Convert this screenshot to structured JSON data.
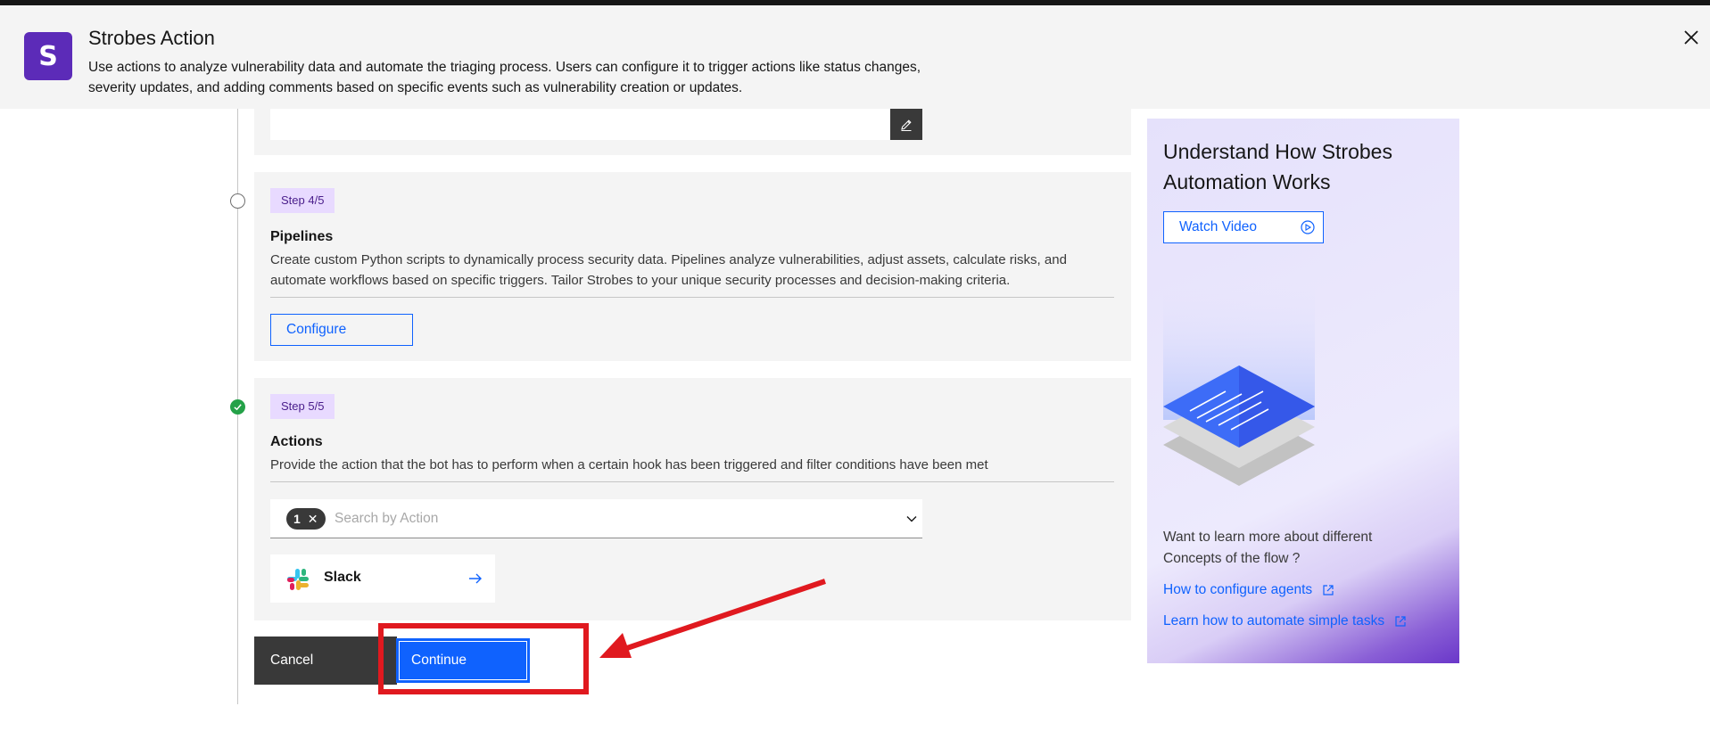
{
  "header": {
    "logo_letter": "S",
    "title": "Strobes Action",
    "description": "Use actions to analyze vulnerability data and automate the triaging process. Users can configure it to trigger actions like status changes, severity updates, and adding comments based on specific events such as vulnerability creation or updates."
  },
  "steps": {
    "step4": {
      "tag": "Step 4/5",
      "title": "Pipelines",
      "description": "Create custom Python scripts to dynamically process security data. Pipelines analyze vulnerabilities, adjust assets, calculate risks, and automate workflows based on specific triggers. Tailor Strobes to your unique security processes and decision-making criteria.",
      "button": "Configure"
    },
    "step5": {
      "tag": "Step 5/5",
      "title": "Actions",
      "description": "Provide the action that the bot has to perform when a certain hook has been triggered and filter conditions have been met",
      "selected_count": "1",
      "search_placeholder": "Search by Action",
      "tile_label": "Slack"
    }
  },
  "footer": {
    "cancel": "Cancel",
    "continue": "Continue"
  },
  "sidebar": {
    "title": "Understand How Strobes Automation Works",
    "watch_video": "Watch Video",
    "question": "Want to learn more about different Concepts of the flow ?",
    "links": [
      {
        "label": "How to configure agents"
      },
      {
        "label": "Learn how to automate simple tasks"
      }
    ]
  },
  "colors": {
    "brand": "#5c2bb8",
    "primary": "#0f62fe",
    "annotation": "#e0191f",
    "success": "#24a148"
  },
  "icons": {
    "close": "close-icon",
    "edit": "edit-icon",
    "chevron": "chevron-down-icon",
    "arrow": "arrow-right-icon",
    "play": "play-icon",
    "external": "external-link-icon"
  }
}
